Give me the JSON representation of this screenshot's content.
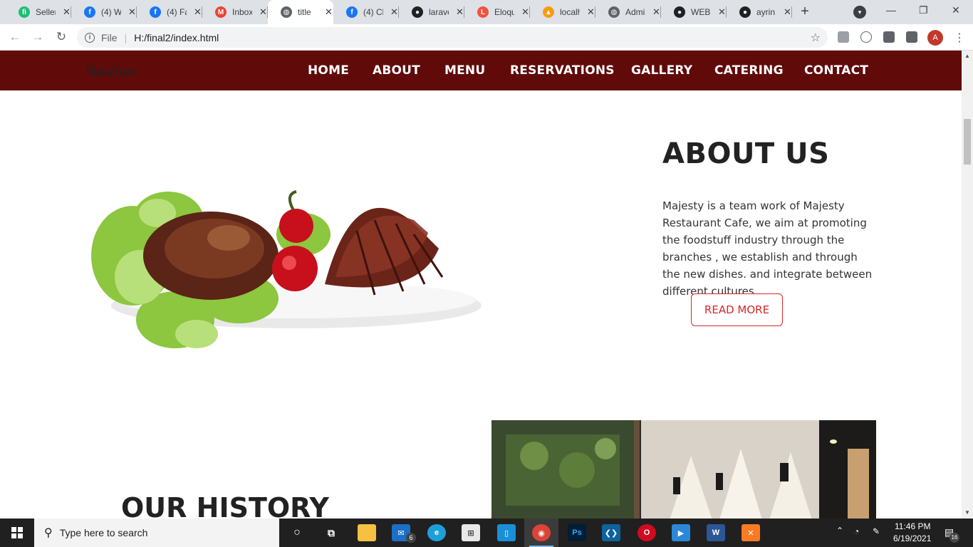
{
  "browser": {
    "tabs": [
      {
        "title": "Seller",
        "favicon": "fiverr-icon",
        "color": "#1dbf73",
        "glyph": "fi"
      },
      {
        "title": "(4) W",
        "favicon": "facebook-icon",
        "color": "#1877f2",
        "glyph": "f"
      },
      {
        "title": "(4) Fa",
        "favicon": "facebook-icon",
        "color": "#1877f2",
        "glyph": "f"
      },
      {
        "title": "Inbox",
        "favicon": "gmail-icon",
        "color": "#ea4335",
        "glyph": "M"
      },
      {
        "title": "title",
        "favicon": "globe-icon",
        "color": "#5f6368",
        "glyph": "◍",
        "active": true
      },
      {
        "title": "(4) Cl",
        "favicon": "facebook-icon",
        "color": "#1877f2",
        "glyph": "f"
      },
      {
        "title": "larave",
        "favicon": "github-icon",
        "color": "#202124",
        "glyph": "●"
      },
      {
        "title": "Eloqu",
        "favicon": "laravel-icon",
        "color": "#f05340",
        "glyph": "L"
      },
      {
        "title": "localh",
        "favicon": "phpmyadmin-icon",
        "color": "#f89c0e",
        "glyph": "▲"
      },
      {
        "title": "Admi",
        "favicon": "globe-icon",
        "color": "#5f6368",
        "glyph": "◍"
      },
      {
        "title": "WEB",
        "favicon": "github-icon",
        "color": "#202124",
        "glyph": "●"
      },
      {
        "title": "ayrin",
        "favicon": "github-icon",
        "color": "#202124",
        "glyph": "●"
      }
    ],
    "address": {
      "scheme": "File",
      "url": "H:/final2/index.html"
    },
    "profile_initial": "A"
  },
  "site": {
    "brand": "Navbar",
    "nav": [
      "HOME",
      "ABOUT",
      "MENU",
      "RESERVATIONS",
      "GALLERY",
      "CATERING",
      "CONTACT"
    ],
    "about": {
      "title": "ABOUT US",
      "text": "Majesty is a team work of Majesty Restaurant Cafe, we aim at promoting the foodstuff industry through the branches , we establish and through the new dishes. and integrate between different cultures.",
      "button": "READ MORE"
    },
    "history": {
      "title": "OUR HISTORY"
    },
    "colors": {
      "nav_bg": "#610a0a",
      "accent": "#d9262a"
    }
  },
  "taskbar": {
    "search_placeholder": "Type here to search",
    "mail_badge": "6",
    "time": "11:46 PM",
    "date": "6/19/2021",
    "notification_count": "16"
  }
}
